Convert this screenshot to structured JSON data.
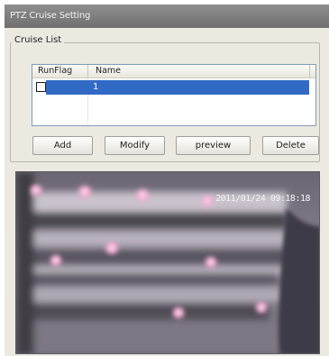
{
  "window": {
    "title": "PTZ Cruise Setting"
  },
  "cruise_list": {
    "legend": "Cruise List",
    "columns": [
      "RunFlag",
      "Name"
    ],
    "rows": [
      {
        "runflag_checked": false,
        "name": "1",
        "selected": true
      }
    ]
  },
  "buttons": {
    "add": "Add",
    "modify": "Modify",
    "preview": "preview",
    "delete": "Delete"
  },
  "video": {
    "timestamp": "2011/01/24 09:18:18"
  },
  "colors": {
    "selection": "#316ac5",
    "titlebar": "#7d7d7d",
    "window_bg": "#ece9e1"
  }
}
